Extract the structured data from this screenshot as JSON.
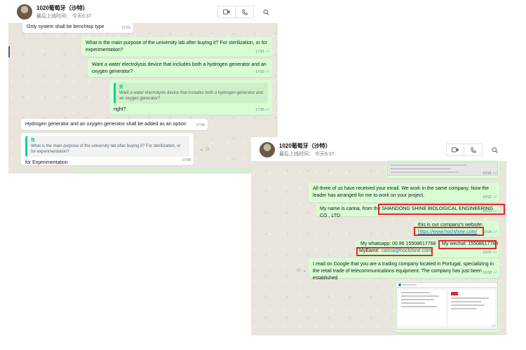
{
  "window1": {
    "contact_name": "1020葡萄牙（沙特）",
    "last_seen": "最后上线时间： 今天6:37",
    "messages": [
      {
        "text": "Only system shall be benchtop type",
        "time": "17:03"
      },
      {
        "text": "What is the main purpose of the university lab after buying it? For sterilization, or for experimentation?",
        "time": "17:01"
      },
      {
        "text": "Want a water electrolysis device that includes both a hydrogen generator and an oxygen generator?",
        "time": "17:02"
      },
      {
        "quote_author": "我",
        "quote_text": "Want a water electrolysis device that includes both a hydrogen generator and an oxygen generator?",
        "text": "right?",
        "time": "17:05"
      },
      {
        "text": "Hydrogen generator and an oxygen generator shall be added as an option",
        "time": "17:06"
      },
      {
        "quote_author": "我",
        "quote_text": "What is the main purpose of the university lab after buying it? For sterilization, or for experimentation?",
        "text": "for Experimentation",
        "time": "17:08"
      }
    ]
  },
  "window2": {
    "contact_name": "1020葡萄牙（沙特）",
    "last_seen": "最后上线时间： 今天6:37",
    "messages": [
      {
        "time": "10:01"
      },
      {
        "text": "All three of us have received your email. We work in the same company. Now the leader has arranged for me to work on your project.",
        "time": "10:02"
      },
      {
        "text_prefix": "My name is carina, from the",
        "company": "SHANDONG SHINE BIOLOGICAL ENGINEERING CO., LTD",
        "time": "10:03"
      },
      {
        "text": "this is our company's website:",
        "link": "https://www.hoclshine.com/",
        "time": "10:04"
      },
      {
        "whatsapp": "My whatsapp: 00 86 15508617768",
        "wechat": "My wechat: 15508617768",
        "email_label": "MyEamil:",
        "email": "carina@hoclshine.com",
        "time": "10:07"
      },
      {
        "text": "I read on Google that you are a trading company located in Portugal, specializing in the retail trade of telecommunications equipment. The company has just been established",
        "time": "10:08"
      },
      {
        "time": "10:08"
      }
    ]
  },
  "colors": {
    "incoming": "#ffffff",
    "outgoing": "#d9fdd3",
    "highlight": "#e0282e",
    "tick": "#53bdeb"
  },
  "icons": [
    "video-call-icon",
    "phone-icon",
    "search-icon",
    "double-check-icon",
    "emoji-icon",
    "chevron-down-icon"
  ]
}
